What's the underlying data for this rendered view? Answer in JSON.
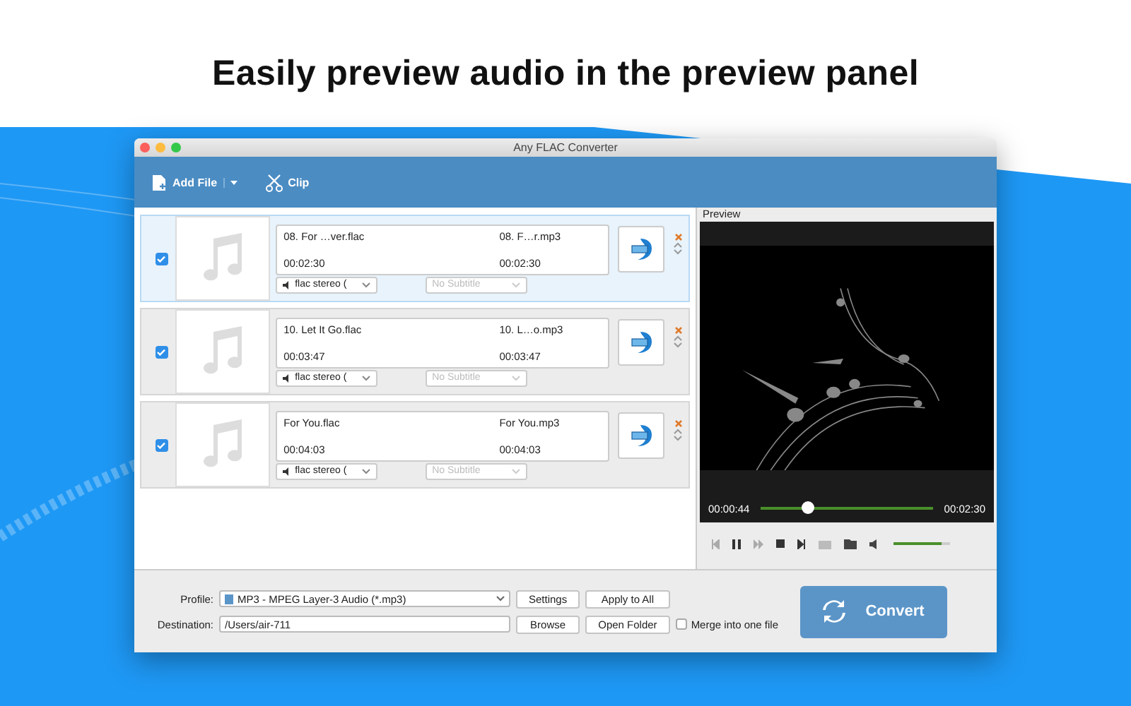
{
  "headline": "Easily preview audio in the preview panel",
  "window": {
    "title": "Any FLAC Converter"
  },
  "toolbar": [
    {
      "kind": "add",
      "label": "Add File"
    },
    {
      "kind": "clip",
      "label": "Clip"
    }
  ],
  "files": [
    {
      "selected": true,
      "checked": true,
      "source": "08. For …ver.flac",
      "target": "08. F…r.mp3",
      "source_duration": "00:02:30",
      "target_duration": "00:02:30",
      "audio": "flac stereo (",
      "subtitle": "No Subtitle"
    },
    {
      "selected": false,
      "checked": true,
      "source": "10. Let It Go.flac",
      "target": "10. L…o.mp3",
      "source_duration": "00:03:47",
      "target_duration": "00:03:47",
      "audio": "flac stereo (",
      "subtitle": "No Subtitle"
    },
    {
      "selected": false,
      "checked": true,
      "source": "For You.flac",
      "target": "For You.mp3",
      "source_duration": "00:04:03",
      "target_duration": "00:04:03",
      "audio": "flac stereo (",
      "subtitle": "No Subtitle"
    }
  ],
  "preview": {
    "label": "Preview",
    "current_time": "00:00:44",
    "total_time": "00:02:30",
    "progress": {
      "level": 0.27
    },
    "volume": {
      "level": 0.85
    }
  },
  "profile": {
    "label": "Profile:",
    "value": "MP3 - MPEG Layer-3 Audio (*.mp3)",
    "buttons": [
      "Settings",
      "Apply to All"
    ]
  },
  "destination": {
    "label": "Destination:",
    "value": "/Users/air-711",
    "buttons": [
      "Browse",
      "Open Folder"
    ]
  },
  "merge": {
    "label": "Merge into one file",
    "checked": false
  },
  "convert": {
    "label": "Convert"
  }
}
